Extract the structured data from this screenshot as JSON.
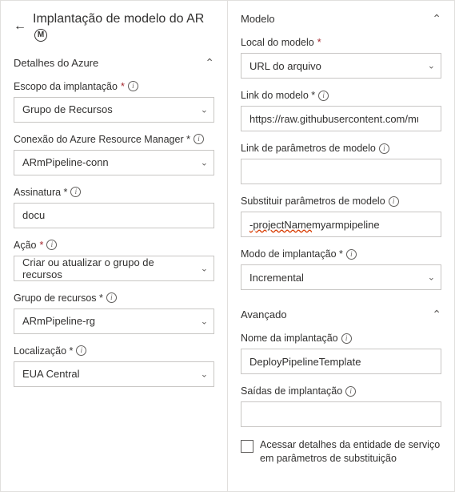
{
  "header": {
    "title": "Implantação de modelo do AR",
    "badge": "M"
  },
  "left": {
    "section_title": "Detalhes do Azure",
    "scope_label": "Escopo da implantação",
    "scope_value": "Grupo de Recursos",
    "conn_label": "Conexão do Azure Resource Manager *",
    "conn_value": "ARmPipeline-conn",
    "sub_label": "Assinatura *",
    "sub_value": "docu",
    "action_label": "Ação",
    "action_value": "Criar ou atualizar o grupo de recursos",
    "rg_label": "Grupo de recursos *",
    "rg_value": "ARmPipeline-rg",
    "loc_label": "Localização *",
    "loc_value": "EUA Central"
  },
  "right": {
    "section_title": "Modelo",
    "tpl_loc_label": "Local do modelo",
    "tpl_loc_value": "URL do arquivo",
    "tpl_link_label": "Link do modelo *",
    "tpl_link_value": "https://raw.githubusercontent.com/mumian/a",
    "param_link_label": "Link de parâmetros de modelo",
    "param_link_value": "",
    "override_label": "Substituir parâmetros de modelo",
    "override_value_a": "-projectName",
    "override_value_b": " myarmpipeline",
    "mode_label": "Modo de implantação *",
    "mode_value": "Incremental",
    "adv_title": "Avançado",
    "dep_name_label": "Nome da implantação",
    "dep_name_value": "DeployPipelineTemplate",
    "outputs_label": "Saídas de implantação",
    "outputs_value": "",
    "chk_label": "Acessar detalhes da entidade de serviço em parâmetros de substituição"
  }
}
